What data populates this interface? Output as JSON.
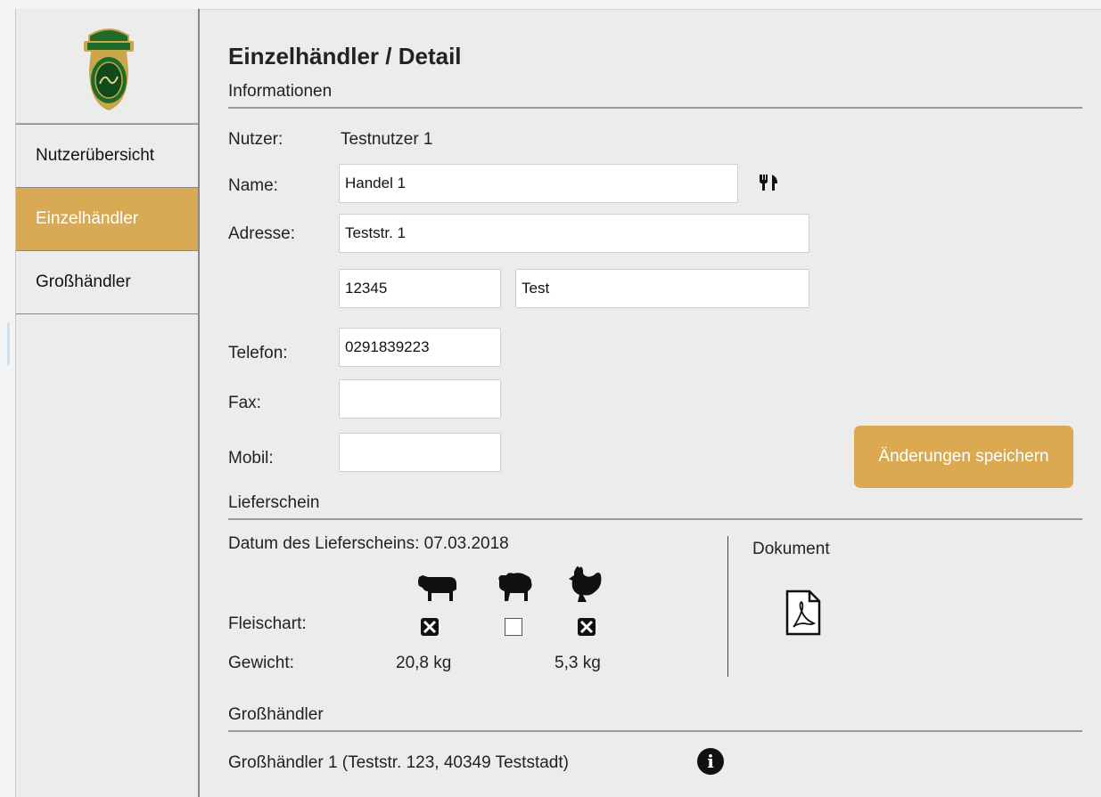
{
  "sidebar": {
    "logo_label": "halal-seal-logo",
    "items": [
      {
        "label": "Nutzerübersicht",
        "active": false
      },
      {
        "label": "Einzelhändler",
        "active": true
      },
      {
        "label": "Großhändler",
        "active": false
      }
    ]
  },
  "page": {
    "title": "Einzelhändler / Detail",
    "section_info": "Informationen",
    "section_delivery": "Lieferschein",
    "section_wholesaler": "Großhändler"
  },
  "info": {
    "user_label": "Nutzer:",
    "user_value": "Testnutzer 1",
    "name_label": "Name:",
    "name_value": "Handel 1",
    "name_icon": "cutlery-icon",
    "address_label": "Adresse:",
    "street_value": "Teststr. 1",
    "zip_value": "12345",
    "city_value": "Test",
    "phone_label": "Telefon:",
    "phone_value": "0291839223",
    "fax_label": "Fax:",
    "fax_value": "",
    "mobile_label": "Mobil:",
    "mobile_value": "",
    "save_button": "Änderungen speichern"
  },
  "delivery": {
    "date_text": "Datum des Lieferscheins: 07.03.2018",
    "meat_label": "Fleischart:",
    "weight_label": "Gewicht:",
    "animals": [
      {
        "icon": "cow-icon",
        "checked": true,
        "weight": "20,8 kg"
      },
      {
        "icon": "sheep-icon",
        "checked": false,
        "weight": ""
      },
      {
        "icon": "chicken-icon",
        "checked": true,
        "weight": "5,3 kg"
      }
    ],
    "document_label": "Dokument",
    "document_icon": "pdf-icon"
  },
  "wholesaler": {
    "text": "Großhändler 1 (Teststr. 123, 40349 Teststadt)",
    "info_icon": "info-icon"
  },
  "colors": {
    "accent": "#daa950",
    "active_nav": "#d9aa55"
  }
}
